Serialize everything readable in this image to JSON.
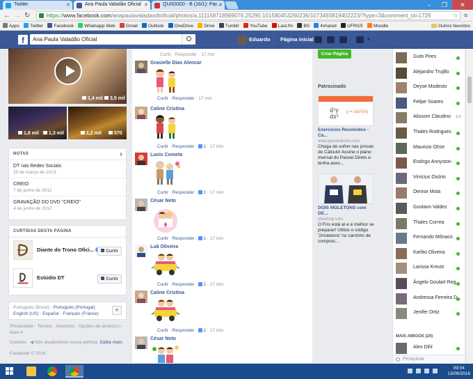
{
  "browser": {
    "tabs": [
      {
        "title": "Twitter",
        "color": "#1da1f2",
        "active": false
      },
      {
        "title": "Ana Paula Valadão Oficial",
        "color": "#3b5998",
        "active": true
      },
      {
        "title": "QUI03320 - B (16/1): Par...",
        "color": "#c33",
        "active": false
      }
    ],
    "url_scheme": "https://",
    "url_host": "www.facebook.com",
    "url_path": "/anapaulavaladaodtoficial/photos/a.111158718969076.25290.101580453260236/1073493819402223/?type=3&comment_id=1726",
    "bookmarks": [
      {
        "label": "Apps",
        "color": "#777"
      },
      {
        "label": "Twitter",
        "color": "#1da1f2"
      },
      {
        "label": "Facebook",
        "color": "#3b5998"
      },
      {
        "label": "Whatsapp Web",
        "color": "#25d366"
      },
      {
        "label": "Gmail",
        "color": "#d44638"
      },
      {
        "label": "Outlook",
        "color": "#0072c6"
      },
      {
        "label": "OneDrive",
        "color": "#0a64c8"
      },
      {
        "label": "Drive",
        "color": "#f4b400"
      },
      {
        "label": "Tumblr",
        "color": "#35465c"
      },
      {
        "label": "YouTube",
        "color": "#e62117"
      },
      {
        "label": "Last.fm",
        "color": "#d51007"
      },
      {
        "label": "BS",
        "color": "#333"
      },
      {
        "label": "4shared",
        "color": "#1e88e5"
      },
      {
        "label": "UFRGS",
        "color": "#222"
      },
      {
        "label": "Moodle",
        "color": "#f98012"
      }
    ],
    "other_bookmarks": "Outros favoritos"
  },
  "fb": {
    "search_value": "Ana Paula Valadão Oficial",
    "user": "Eduardo",
    "home": "Página inicial"
  },
  "left": {
    "main_stats": {
      "views": "1,4 mil",
      "comments": "3,5 mil"
    },
    "thumb1_stats": {
      "a": "1,8 mil",
      "b": "1,3 mil"
    },
    "thumb2_stats": {
      "a": "1,2 mil",
      "b": "570"
    },
    "notes_header": "NOTAS",
    "notes": [
      {
        "title": "DT nas Redes Sociais",
        "date": "20 de março de 2013"
      },
      {
        "title": "CREIO",
        "date": "7 de junho de 2012"
      },
      {
        "title": "GRAVAÇÃO DO DVD \"CREIO\"",
        "date": "4 de junho de 2012"
      }
    ],
    "liked_header": "CURTIDAS DESTA PÁGINA",
    "liked": [
      {
        "name": "Diante do Trono Ofici...",
        "button": "Curtir"
      },
      {
        "name": "Estúdio DT",
        "button": "Curtir"
      }
    ],
    "languages": {
      "current": "Português (Brasil)",
      "others": [
        "Português (Portugal)",
        "English (US)",
        "Español",
        "Français (France)"
      ]
    },
    "footer_links": "Privacidade · Termos · Anúncios · Opções de anúncio ▷ · Mais ▾",
    "cookies_text": "Cookies · ◀ Nós atualizamos nossa política.",
    "cookies_link": "Saiba mais.",
    "copyright": "Facebook © 2016"
  },
  "comments": {
    "top_meta": "Curtir · Responder · 17 min",
    "items": [
      {
        "name": "Grasielle Dias Alencar",
        "likes": "",
        "time": "17 min"
      },
      {
        "name": "Caline Cristina",
        "likes": "1",
        "time": "17 min"
      },
      {
        "name": "Luois Cometa",
        "likes": "1",
        "time": "17 min"
      },
      {
        "name": "César Neto",
        "likes": "1",
        "time": "17 min"
      },
      {
        "name": "Luã Oliveira",
        "likes": "1",
        "time": "17 min"
      },
      {
        "name": "Caline Cristina",
        "likes": "1",
        "time": "17 min"
      },
      {
        "name": "César Neto",
        "likes": "",
        "time": ""
      }
    ],
    "curtir": "Curtir",
    "responder": "Responder"
  },
  "right": {
    "create_page": "Criar Página",
    "sponsored": "Patrocinado",
    "ads": [
      {
        "title": "Exercícios Resolvidos - Cá...",
        "host": "www.passeidireto.com",
        "body": "Chega de sofrer nas provas de Cálculo! Assine o plano mensal do Passei Direto e tenha aces..."
      },
      {
        "title": "DOIS MOLETONS com DE...",
        "host": "obashop.com",
        "body": "O Frio está aí e é melhor se preparar! Utilize o código '2moletons' no carrinho de compras..."
      }
    ],
    "ad1_formula": "y = cos²(5x)"
  },
  "chat": {
    "friends": [
      {
        "name": "Guto Pires",
        "status": "online"
      },
      {
        "name": "Alejandro Trujillo",
        "status": "online"
      },
      {
        "name": "Deyse Modesto",
        "status": "online"
      },
      {
        "name": "Felipe Soares",
        "status": "online"
      },
      {
        "name": "Alissom Claudino",
        "status": "1m"
      },
      {
        "name": "Thales Rodrigues",
        "status": "online"
      },
      {
        "name": "Mauricio Ohse",
        "status": "online"
      },
      {
        "name": "Endrigo Annyston",
        "status": "online"
      },
      {
        "name": "Vinícius Osório",
        "status": "online"
      },
      {
        "name": "Denise Mota",
        "status": "online"
      },
      {
        "name": "Gustavo Valdez",
        "status": "online"
      },
      {
        "name": "Thales Correa",
        "status": "online"
      },
      {
        "name": "Fernando Mônaco",
        "status": "online"
      },
      {
        "name": "Karlito Oliveira",
        "status": "online"
      },
      {
        "name": "Larissa Kreutz",
        "status": "online"
      },
      {
        "name": "Ângelo Goulart Reg...",
        "status": "online"
      },
      {
        "name": "Andressa Ferreira D...",
        "status": "online"
      },
      {
        "name": "Jenifer Ortiz",
        "status": "online"
      }
    ],
    "more_friends": "MAIS AMIGOS (24)",
    "extra_friend": "Alex Dihl",
    "search_placeholder": "Pesquisar"
  },
  "taskbar": {
    "time": "09:04",
    "date": "13/06/2016"
  }
}
